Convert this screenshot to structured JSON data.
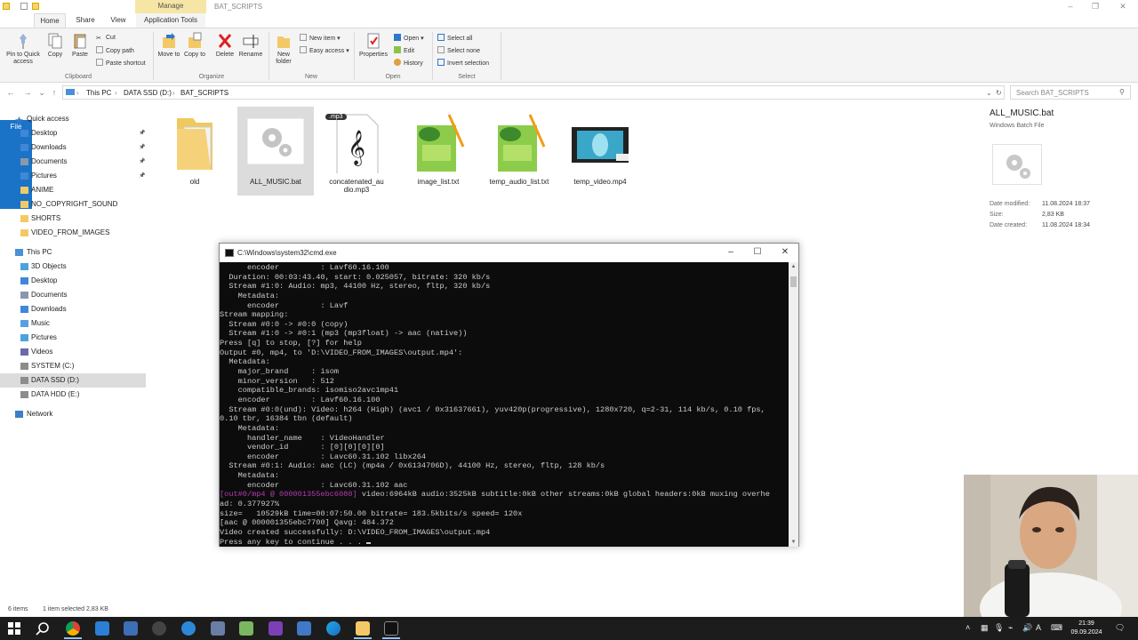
{
  "window": {
    "title": "BAT_SCRIPTS",
    "manage_tab": "Manage"
  },
  "tabs": {
    "file": "File",
    "home": "Home",
    "share": "Share",
    "view": "View",
    "app_tools": "Application Tools"
  },
  "ribbon": {
    "pin": "Pin to Quick access",
    "copy": "Copy",
    "paste": "Paste",
    "cut": "Cut",
    "copy_path": "Copy path",
    "paste_shortcut": "Paste shortcut",
    "clipboard": "Clipboard",
    "move_to": "Move to",
    "copy_to": "Copy to",
    "delete": "Delete",
    "rename": "Rename",
    "organize": "Organize",
    "new_folder": "New folder",
    "new_item": "New item",
    "easy_access": "Easy access",
    "new": "New",
    "properties": "Properties",
    "open": "Open",
    "edit": "Edit",
    "history": "History",
    "open_group": "Open",
    "select_all": "Select all",
    "select_none": "Select none",
    "invert_selection": "Invert selection",
    "select_group": "Select"
  },
  "address": {
    "crumbs": [
      "This PC",
      "DATA SSD (D:)",
      "BAT_SCRIPTS"
    ],
    "search_placeholder": "Search BAT_SCRIPTS"
  },
  "nav": {
    "quick_access": "Quick access",
    "quick_items": [
      "Desktop",
      "Downloads",
      "Documents",
      "Pictures",
      "ANIME",
      "NO_COPYRIGHT_SOUND",
      "SHORTS",
      "VIDEO_FROM_IMAGES"
    ],
    "this_pc": "This PC",
    "pc_items": [
      "3D Objects",
      "Desktop",
      "Documents",
      "Downloads",
      "Music",
      "Pictures",
      "Videos",
      "SYSTEM (C:)",
      "DATA SSD (D:)",
      "DATA HDD (E:)"
    ],
    "network": "Network"
  },
  "files": [
    {
      "name": "old",
      "type": "folder"
    },
    {
      "name": "ALL_MUSIC.bat",
      "type": "bat"
    },
    {
      "name": "concatenated_audio.mp3",
      "type": "mp3",
      "badge": ".mp3"
    },
    {
      "name": "image_list.txt",
      "type": "txt"
    },
    {
      "name": "temp_audio_list.txt",
      "type": "txt"
    },
    {
      "name": "temp_video.mp4",
      "type": "video"
    }
  ],
  "details": {
    "name": "ALL_MUSIC.bat",
    "type": "Windows Batch File",
    "rows": [
      {
        "k": "Date modified:",
        "v": "11.08.2024 18:37"
      },
      {
        "k": "Size:",
        "v": "2,83 KB"
      },
      {
        "k": "Date created:",
        "v": "11.08.2024 18:34"
      }
    ]
  },
  "status": {
    "count": "6 items",
    "selected": "1 item selected  2,83 KB"
  },
  "cmd": {
    "title": "C:\\Windows\\system32\\cmd.exe",
    "lines": [
      {
        "pre": "",
        "text": "      encoder         : Lavf60.16.100"
      },
      {
        "pre": "",
        "text": "  Duration: 00:03:43.40, start: 0.025057, bitrate: 320 kb/s"
      },
      {
        "pre": "",
        "text": "  Stream #1:0: Audio: mp3, 44100 Hz, stereo, fltp, 320 kb/s"
      },
      {
        "pre": "",
        "text": "    Metadata:"
      },
      {
        "pre": "",
        "text": "      encoder         : Lavf"
      },
      {
        "pre": "",
        "text": "Stream mapping:"
      },
      {
        "pre": "",
        "text": "  Stream #0:0 -> #0:0 (copy)"
      },
      {
        "pre": "",
        "text": "  Stream #1:0 -> #0:1 (mp3 (mp3float) -> aac (native))"
      },
      {
        "pre": "",
        "text": "Press [q] to stop, [?] for help"
      },
      {
        "pre": "",
        "text": "Output #0, mp4, to 'D:\\VIDEO_FROM_IMAGES\\output.mp4':"
      },
      {
        "pre": "",
        "text": "  Metadata:"
      },
      {
        "pre": "",
        "text": "    major_brand     : isom"
      },
      {
        "pre": "",
        "text": "    minor_version   : 512"
      },
      {
        "pre": "",
        "text": "    compatible_brands: isomiso2avc1mp41"
      },
      {
        "pre": "",
        "text": "    encoder         : Lavf60.16.100"
      },
      {
        "pre": "",
        "text": "  Stream #0:0(und): Video: h264 (High) (avc1 / 0x31637661), yuv420p(progressive), 1280x720, q=2-31, 114 kb/s, 0.10 fps,"
      },
      {
        "pre": "",
        "text": "0.10 tbr, 16384 tbn (default)"
      },
      {
        "pre": "",
        "text": "    Metadata:"
      },
      {
        "pre": "",
        "text": "      handler_name    : VideoHandler"
      },
      {
        "pre": "",
        "text": "      vendor_id       : [0][0][0][0]"
      },
      {
        "pre": "",
        "text": "      encoder         : Lavc60.31.102 libx264"
      },
      {
        "pre": "",
        "text": "  Stream #0:1: Audio: aac (LC) (mp4a / 0x6134706D), 44100 Hz, stereo, fltp, 128 kb/s"
      },
      {
        "pre": "",
        "text": "    Metadata:"
      },
      {
        "pre": "",
        "text": "      encoder         : Lavc60.31.102 aac"
      },
      {
        "pre": "[out#0/mp4 @ 000001355ebc6080]",
        "text": " video:6964kB audio:3525kB subtitle:0kB other streams:0kB global headers:0kB muxing overhe"
      },
      {
        "pre": "",
        "text": "ad: 0.377927%"
      },
      {
        "pre": "",
        "text": "size=   10529kB time=00:07:50.00 bitrate= 183.5kbits/s speed= 120x"
      },
      {
        "pre": "",
        "text": "[aac @ 000001355ebc7700] Qavg: 484.372"
      },
      {
        "pre": "",
        "text": "Video created successfully: D:\\VIDEO_FROM_IMAGES\\output.mp4"
      },
      {
        "pre": "",
        "text": "Press any key to continue . . . "
      }
    ]
  },
  "taskbar": {
    "time": "21:39",
    "date": "09.09.2024",
    "lang": "A"
  },
  "colors": {
    "accent": "#1a73c7",
    "manage": "#f6e6a5",
    "console_bg": "#0c0c0c",
    "console_text": "#cccccc",
    "console_magenta": "#b63bb3",
    "taskbar": "#1c1c1c"
  }
}
